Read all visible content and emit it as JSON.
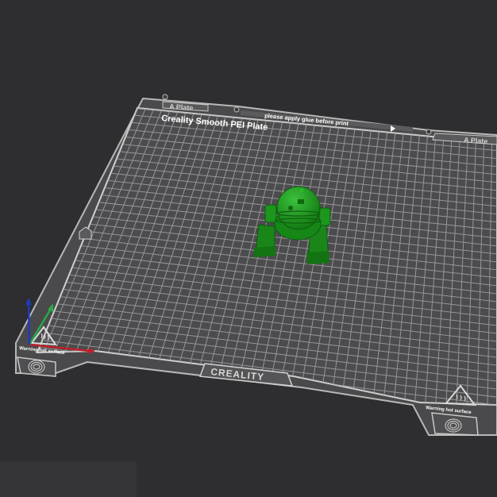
{
  "scene": {
    "background_color": "#2e2e30",
    "bed": {
      "fill_color": "#4a4a4c",
      "grid_color": "#9a9a9c",
      "border_color": "#c8c8c8",
      "plate_title": "Creality Smooth PEI Plate",
      "glue_notice": "please apply glue before print",
      "plate_tab_left": "A Plate",
      "plate_tab_right": "A Plate",
      "brand_label": "CREALITY",
      "warning_left": "Warning hot surface",
      "warning_right": "Warning hot surface",
      "fingerprint_icon": "fingerprint-icon",
      "hot_surface_icon": "hot-surface-warning-icon"
    },
    "model": {
      "color": "#1e8c1e",
      "shadow_color": "#0f5a12"
    },
    "axes": {
      "x_color": "#c0202a",
      "y_color": "#2aa84a",
      "z_color": "#1f3bb5"
    }
  }
}
